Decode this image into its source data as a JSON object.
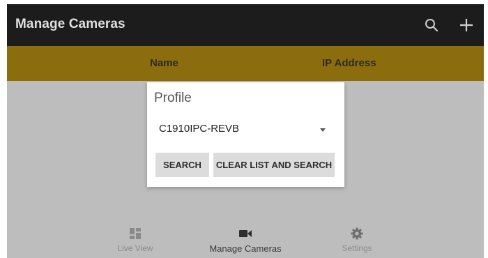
{
  "app": {
    "title": "Manage Cameras",
    "icons": {
      "search": "search-icon",
      "add": "plus-icon"
    },
    "colors": {
      "topbar": "#1c1c1c",
      "header_band": "#8c6d0e",
      "background": "#bdbdbd"
    }
  },
  "table": {
    "columns": [
      "Name",
      "IP Address"
    ]
  },
  "dialog": {
    "title": "Profile",
    "selected_profile": "C1910IPC-REVB",
    "search_label": "SEARCH",
    "clear_search_label": "CLEAR LIST AND SEARCH"
  },
  "nav": {
    "items": [
      {
        "label": "Live View",
        "icon": "grid-icon",
        "active": false
      },
      {
        "label": "Manage Cameras",
        "icon": "video-camera-icon",
        "active": true
      },
      {
        "label": "Settings",
        "icon": "gear-icon",
        "active": false
      }
    ]
  }
}
